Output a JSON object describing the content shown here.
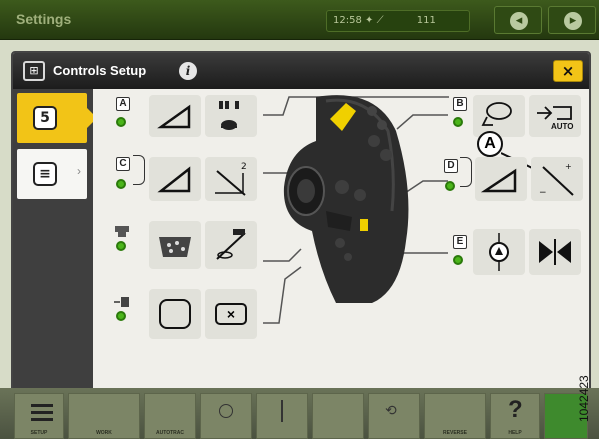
{
  "topbar": {
    "title": "Settings",
    "clock": "12:58",
    "gps_value": "111"
  },
  "dialog": {
    "title": "Controls Setup",
    "info_icon": "info-icon",
    "close_label": "×"
  },
  "side_tabs": [
    {
      "name": "controls-setup-tab",
      "icon": "joystick-config-icon",
      "glyph": "5"
    },
    {
      "name": "display-setup-tab",
      "icon": "display-list-icon",
      "glyph": "≡"
    }
  ],
  "buttons": {
    "A": {
      "letter": "A",
      "functions": [
        "header-height-icon",
        "reel-speed-icon"
      ]
    },
    "B": {
      "letter": "B",
      "functions": [
        "reel-fore-aft-icon",
        "auto-header-icon"
      ],
      "auto_label": "AUTO"
    },
    "C": {
      "letter": "C",
      "functions": [
        "header-tilt-icon",
        "header-tilt-cancel-icon"
      ]
    },
    "D": {
      "letter": "D",
      "functions": [
        "header-angle-icon",
        "header-angle-sign-icon"
      ]
    },
    "E": {
      "letter": "E",
      "functions": [
        "auto-center-icon",
        "center-position-icon"
      ]
    },
    "unloader": {
      "functions": [
        "unloader-icon",
        "grain-tank-icon",
        "unloader-cancel-icon"
      ]
    },
    "extra": {
      "functions": [
        "accessory-icon",
        "blank-icon",
        "cancel-icon"
      ],
      "cancel_label": "×"
    }
  },
  "callout": {
    "label": "A"
  },
  "bottom_bar": [
    {
      "label": "SETUP"
    },
    {
      "label": "WORK"
    },
    {
      "label": "AUTOTRAC"
    },
    {
      "label": ""
    },
    {
      "label": ""
    },
    {
      "label": ""
    },
    {
      "label": ""
    },
    {
      "label": "REVERSE"
    },
    {
      "label": "HELP"
    },
    {
      "label": ""
    }
  ],
  "figure_id": "1042423"
}
